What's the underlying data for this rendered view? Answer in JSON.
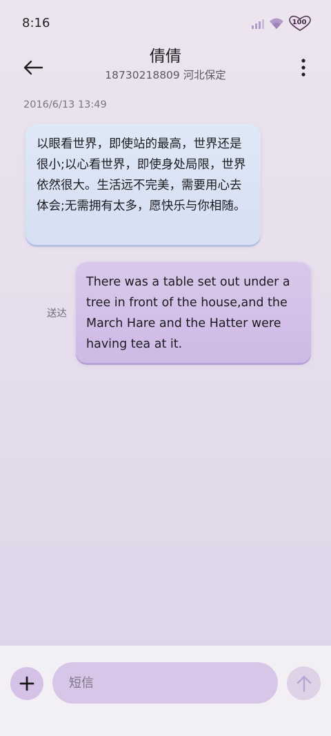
{
  "status_bar": {
    "time": "8:16",
    "battery_level": "100",
    "icons": [
      "signal-icon",
      "wifi-icon",
      "battery-icon"
    ]
  },
  "header": {
    "contact_name": "倩倩",
    "contact_info": "18730218809 河北保定",
    "icons": [
      "back-arrow-icon",
      "more-vert-icon"
    ]
  },
  "conversation": {
    "timestamp": "2016/6/13 13:49",
    "messages": [
      {
        "direction": "incoming",
        "text": "以眼看世界，即使站的最高，世界还是很小;以心看世界，即使身处局限，世界依然很大。生活远不完美，需要用心去体会;无需拥有太多，愿快乐与你相随。"
      },
      {
        "direction": "outgoing",
        "text": "There was a table set out under a tree in front of the house,and the March Hare and the Hatter were having tea at it.",
        "status": "送达"
      }
    ]
  },
  "composer": {
    "placeholder": "短信",
    "value": "",
    "icons": [
      "plus-icon",
      "send-arrow-icon"
    ]
  },
  "colors": {
    "incoming_bubble": "#dbe4f5",
    "outgoing_bubble": "#d4c0e8",
    "input_field": "#d7c6e7",
    "accent": "#b9a4d4"
  }
}
